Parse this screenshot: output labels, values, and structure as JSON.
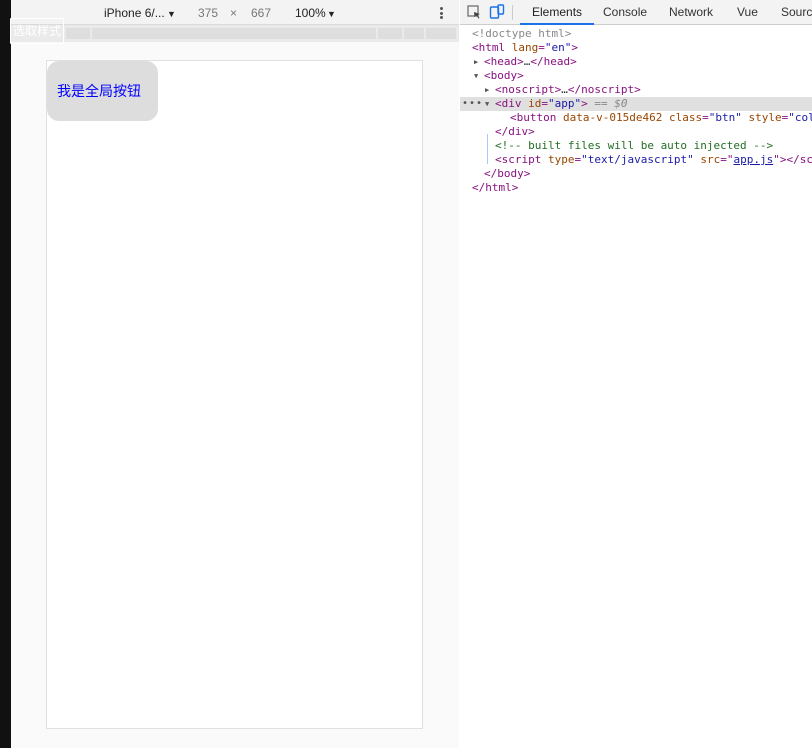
{
  "device_toolbar": {
    "device": "iPhone 6/...",
    "width": "375",
    "times": "×",
    "height": "667",
    "zoom": "100%"
  },
  "selected_badge": "选取样式",
  "app": {
    "button_label": "我是全局按钮"
  },
  "devtools": {
    "tabs": [
      "Elements",
      "Console",
      "Network",
      "Vue",
      "Sources"
    ],
    "dom": {
      "doctype": "<!doctype html>",
      "html_tag": "html",
      "html_attr": "lang",
      "html_val": "\"en\"",
      "head": "head",
      "head_ellipsis": "…",
      "body": "body",
      "noscript": "noscript",
      "div_tag": "div",
      "div_attr": "id",
      "div_val": "\"app\"",
      "sel_marker": "== $0",
      "button_tag": "button",
      "button_attr1": "data-v-015de462",
      "button_attr2": "class",
      "button_val2": "\"btn\"",
      "button_attr3": "style",
      "button_val3": "\"colo",
      "div_close": "div",
      "comment": "<!-- built files will be auto injected -->",
      "script_tag": "script",
      "script_attr1": "type",
      "script_val1": "\"text/javascript\"",
      "script_attr2": "src",
      "script_src": "app.js",
      "script_tail": "sc",
      "body_close": "body",
      "html_close": "html"
    }
  }
}
